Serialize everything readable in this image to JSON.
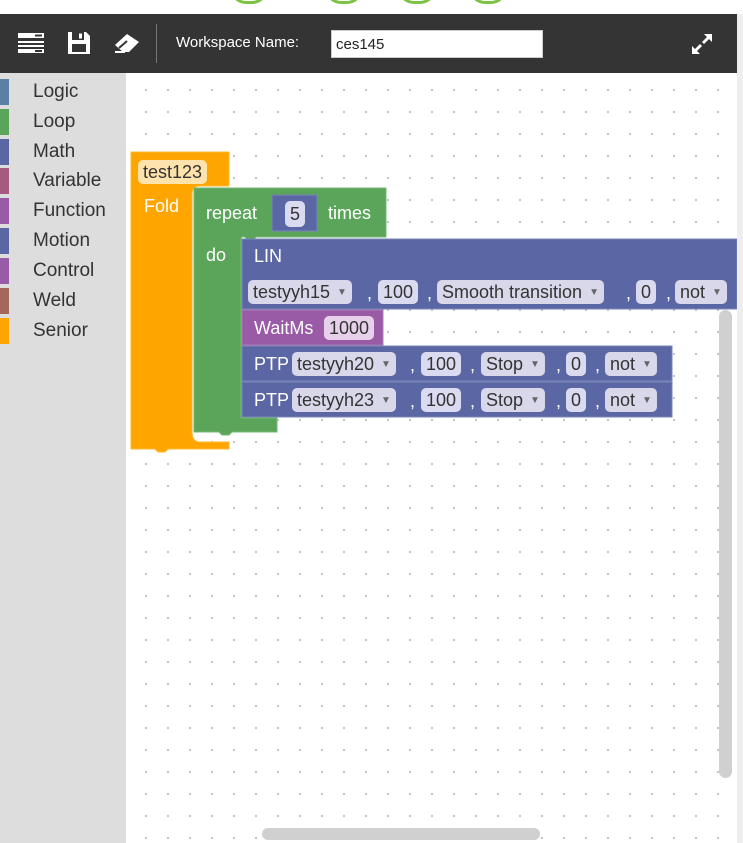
{
  "colors": {
    "toolbar_bg": "#343434",
    "sidebar_bg": "#dddddd",
    "senior_orange": "#ffa500",
    "loop_green": "#5ba55b",
    "motion_blue": "#5b67a5",
    "function_purple": "#9a5ba5"
  },
  "toolbar": {
    "icons": [
      "list-icon",
      "save-icon",
      "eraser-icon"
    ],
    "workspace_label": "Workspace Name:",
    "workspace_name": "ces145",
    "fullscreen_icon": "fullscreen-icon"
  },
  "categories": [
    {
      "label": "Logic",
      "color": "#5b80a5"
    },
    {
      "label": "Loop",
      "color": "#5ba55b"
    },
    {
      "label": "Math",
      "color": "#5b67a5"
    },
    {
      "label": "Variable",
      "color": "#a55b80"
    },
    {
      "label": "Function",
      "color": "#995ba5"
    },
    {
      "label": "Motion",
      "color": "#5b67a5"
    },
    {
      "label": "Control",
      "color": "#995ba5"
    },
    {
      "label": "Weld",
      "color": "#a5675b"
    },
    {
      "label": "Senior",
      "color": "#ffa500"
    }
  ],
  "blocks": {
    "fold": {
      "name": "test123",
      "label": "Fold"
    },
    "repeat": {
      "label": "repeat",
      "count": "5",
      "suffix": "times",
      "do_label": "do"
    },
    "lin": {
      "label": "LIN",
      "point": "testyyh15",
      "speed": "100",
      "mode": "Smooth transition",
      "value": "0",
      "flag": "not"
    },
    "waitms": {
      "label": "WaitMs",
      "value": "1000"
    },
    "ptp1": {
      "label": "PTP",
      "point": "testyyh20",
      "speed": "100",
      "mode": "Stop",
      "value": "0",
      "flag": "not"
    },
    "ptp2": {
      "label": "PTP",
      "point": "testyyh23",
      "speed": "100",
      "mode": "Stop",
      "value": "0",
      "flag": "not"
    },
    "separator": ","
  }
}
